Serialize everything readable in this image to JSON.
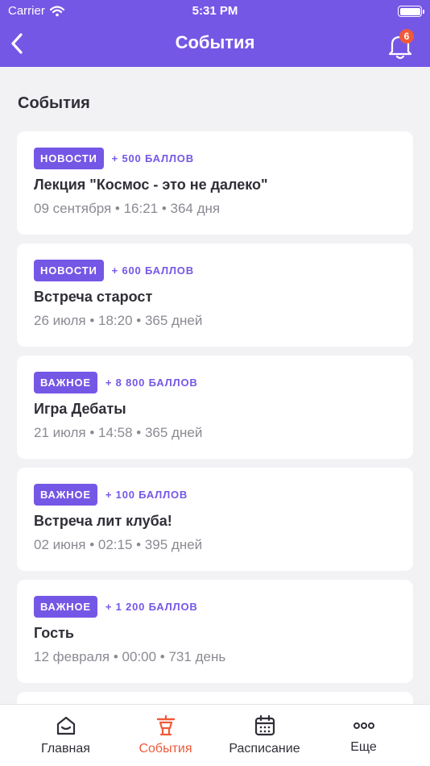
{
  "status_bar": {
    "carrier": "Carrier",
    "time": "5:31 PM"
  },
  "nav": {
    "title": "События",
    "notifications_count": "6"
  },
  "section": {
    "title": "События"
  },
  "events": [
    {
      "tag": "НОВОСТИ",
      "points": "+ 500 БАЛЛОВ",
      "title": "Лекция \"Космос - это не далеко\"",
      "meta": "09 сентября • 16:21 • 364 дня"
    },
    {
      "tag": "НОВОСТИ",
      "points": "+ 600 БАЛЛОВ",
      "title": "Встреча старост",
      "meta": "26 июля • 18:20 • 365 дней"
    },
    {
      "tag": "ВАЖНОЕ",
      "points": "+ 8 800 БАЛЛОВ",
      "title": "Игра Дебаты",
      "meta": "21 июля • 14:58 • 365 дней"
    },
    {
      "tag": "ВАЖНОЕ",
      "points": "+ 100 БАЛЛОВ",
      "title": "Встреча лит клуба!",
      "meta": "02 июня • 02:15 • 395 дней"
    },
    {
      "tag": "ВАЖНОЕ",
      "points": "+ 1 200 БАЛЛОВ",
      "title": "Гость",
      "meta": "12 февраля • 00:00 • 731 день"
    }
  ],
  "tabbar": {
    "items": [
      {
        "label": "Главная",
        "icon": "home-icon"
      },
      {
        "label": "События",
        "icon": "podium-icon",
        "active": true
      },
      {
        "label": "Расписание",
        "icon": "calendar-icon"
      },
      {
        "label": "Еще",
        "icon": "more-dots-icon"
      }
    ]
  },
  "colors": {
    "accent": "#7557e6",
    "active_tab": "#ef5a3a",
    "badge": "#ef5a3a"
  }
}
